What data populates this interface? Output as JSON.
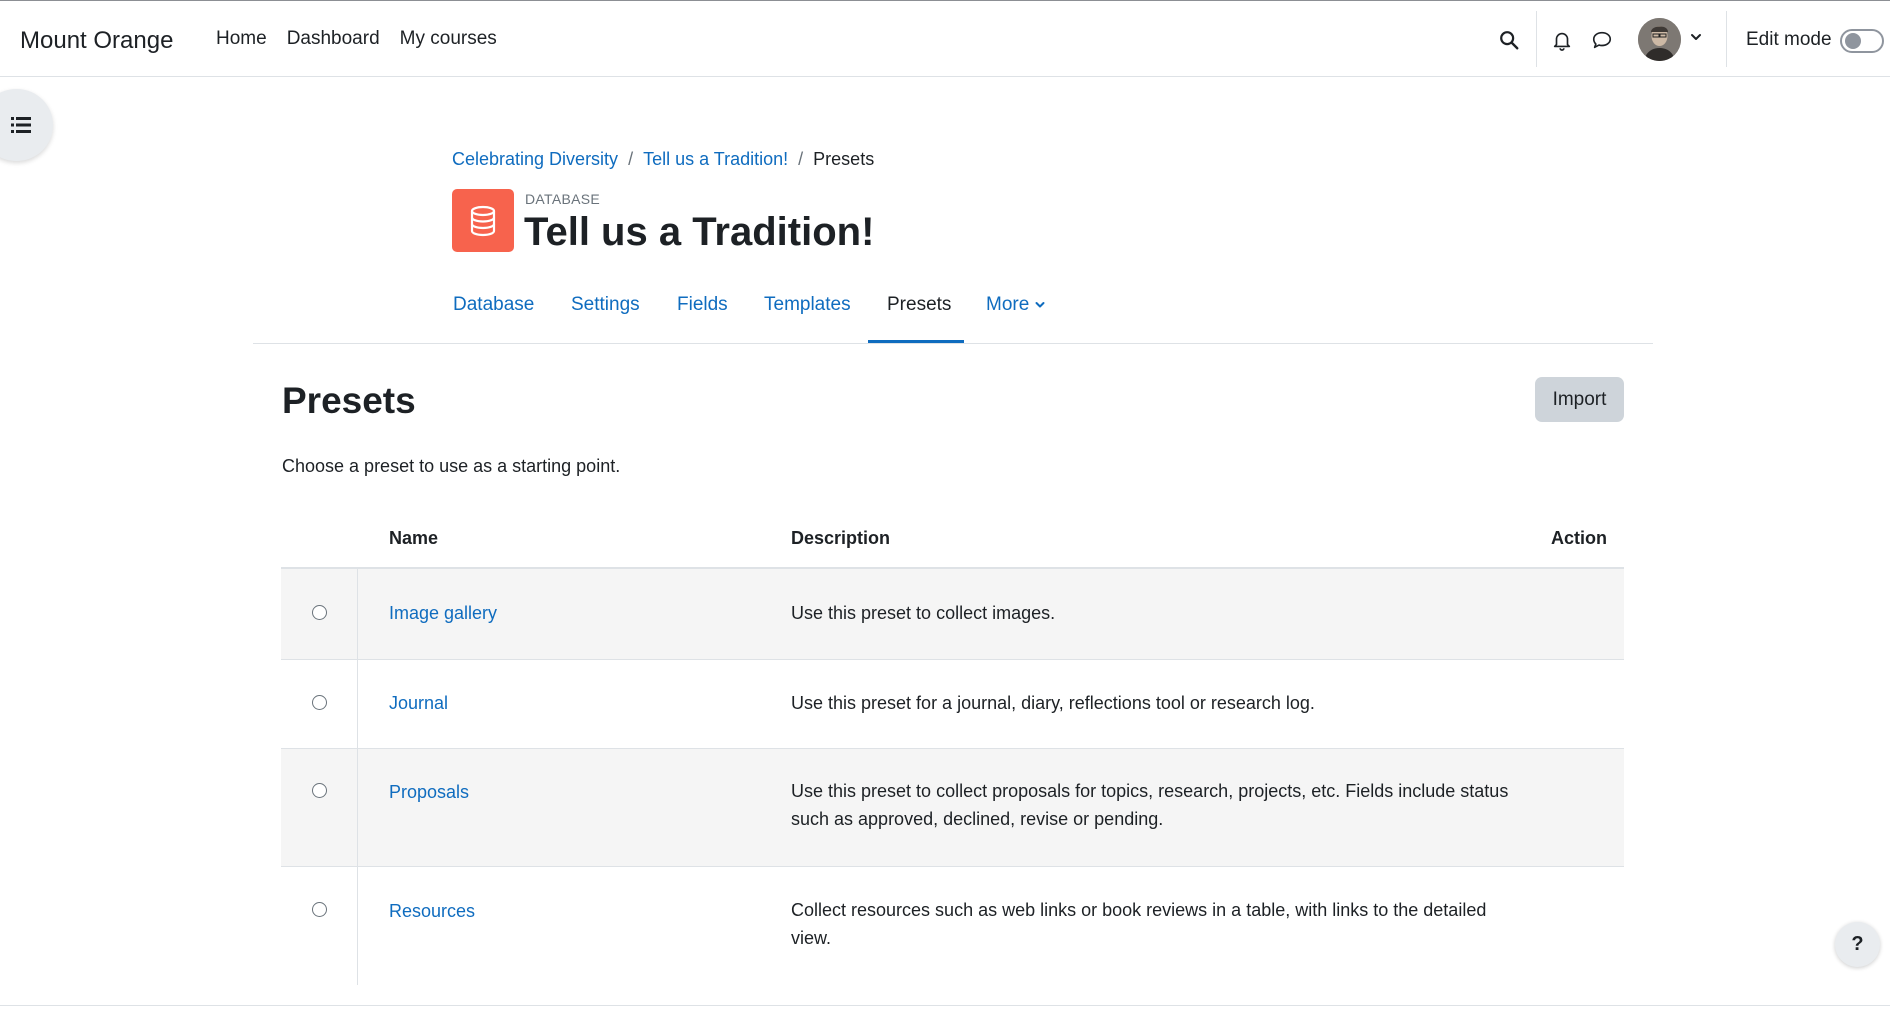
{
  "site": {
    "name": "Mount Orange"
  },
  "primary_nav": [
    {
      "label": "Home"
    },
    {
      "label": "Dashboard"
    },
    {
      "label": "My courses"
    }
  ],
  "user_menu": {
    "edit_mode_label": "Edit mode",
    "edit_mode_on": false
  },
  "breadcrumb": [
    {
      "label": "Celebrating Diversity"
    },
    {
      "label": "Tell us a Tradition!"
    },
    {
      "label": "Presets"
    }
  ],
  "activity": {
    "type_label": "DATABASE",
    "title": "Tell us a Tradition!",
    "icon": "database-icon",
    "icon_color": "#f7634d"
  },
  "secondary_nav": {
    "tabs": [
      {
        "label": "Database"
      },
      {
        "label": "Settings"
      },
      {
        "label": "Fields"
      },
      {
        "label": "Templates"
      },
      {
        "label": "Presets",
        "active": true
      },
      {
        "label": "More"
      }
    ]
  },
  "content": {
    "heading": "Presets",
    "import_label": "Import",
    "intro": "Choose a preset to use as a starting point.",
    "table": {
      "columns": {
        "name": "Name",
        "description": "Description",
        "action": "Action"
      },
      "rows": [
        {
          "name": "Image gallery",
          "description": "Use this preset to collect images."
        },
        {
          "name": "Journal",
          "description": "Use this preset for a journal, diary, reflections tool or research log."
        },
        {
          "name": "Proposals",
          "description": "Use this preset to collect proposals for topics, research, projects, etc. Fields include status such as approved, declined, revise or pending."
        },
        {
          "name": "Resources",
          "description": "Collect resources such as web links or book reviews in a table, with links to the detailed view."
        }
      ]
    }
  },
  "help": {
    "label": "?"
  },
  "colors": {
    "link": "#0f6cbf",
    "text": "#1d2125",
    "accent": "#0f6cbf"
  }
}
